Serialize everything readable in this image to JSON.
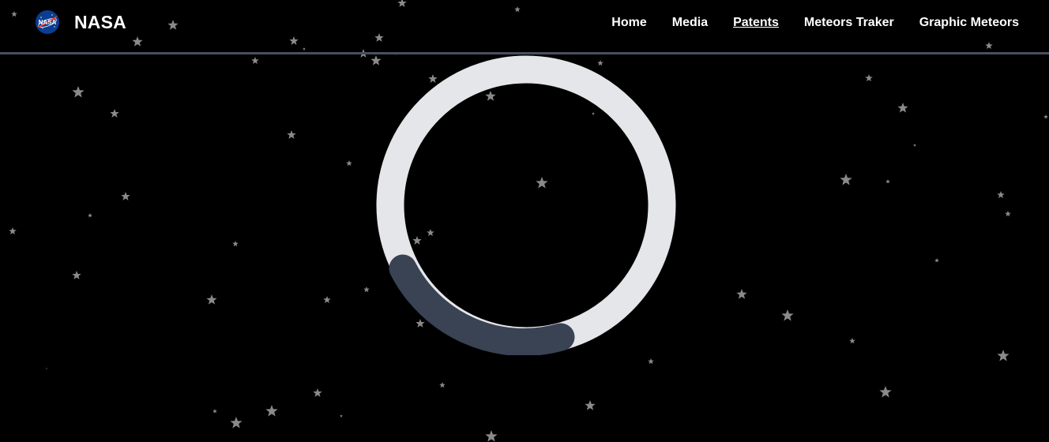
{
  "brand": {
    "name": "NASA",
    "logo_text": "NASA",
    "logo_icon": "nasa-meatball-icon"
  },
  "nav": {
    "items": [
      {
        "label": "Home",
        "active": false
      },
      {
        "label": "Media",
        "active": false
      },
      {
        "label": "Patents",
        "active": true
      },
      {
        "label": "Meteors Traker",
        "active": false
      },
      {
        "label": "Graphic Meteors",
        "active": false
      }
    ]
  },
  "loader": {
    "icon": "loading-spinner-icon",
    "track_color": "#e5e6ea",
    "indicator_color": "#3a4354"
  },
  "colors": {
    "background": "#000000",
    "divider": "#4a4f5e",
    "star": "#8a8a8a",
    "text": "#ffffff"
  }
}
